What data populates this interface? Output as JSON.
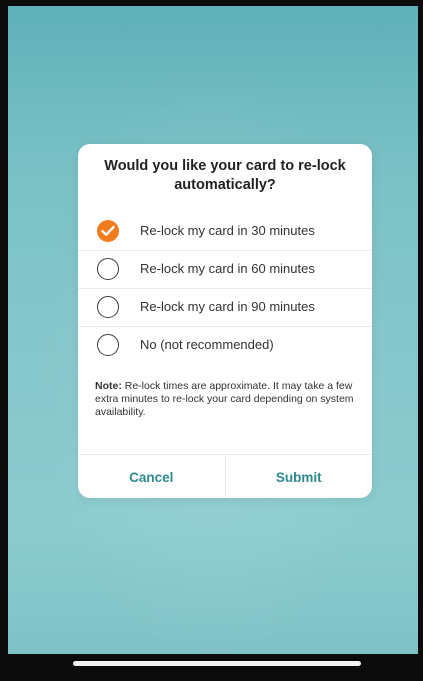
{
  "dialog": {
    "title": "Would you like your card to re-lock automatically?",
    "options": [
      {
        "label": "Re-lock my card in 30 minutes",
        "selected": true
      },
      {
        "label": "Re-lock my card in 60 minutes",
        "selected": false
      },
      {
        "label": "Re-lock my card in 90 minutes",
        "selected": false
      },
      {
        "label": "No (not recommended)",
        "selected": false
      }
    ],
    "note_label": "Note:",
    "note_text": " Re-lock times are approximate. It may take a few extra minutes to re-lock your card depending on system availability.",
    "cancel_label": "Cancel",
    "submit_label": "Submit"
  },
  "colors": {
    "accent_orange": "#f07c1e",
    "button_teal": "#2e8b8c",
    "background_teal": "#86c7cb"
  },
  "icons": {
    "selected": "checkmark-icon"
  }
}
